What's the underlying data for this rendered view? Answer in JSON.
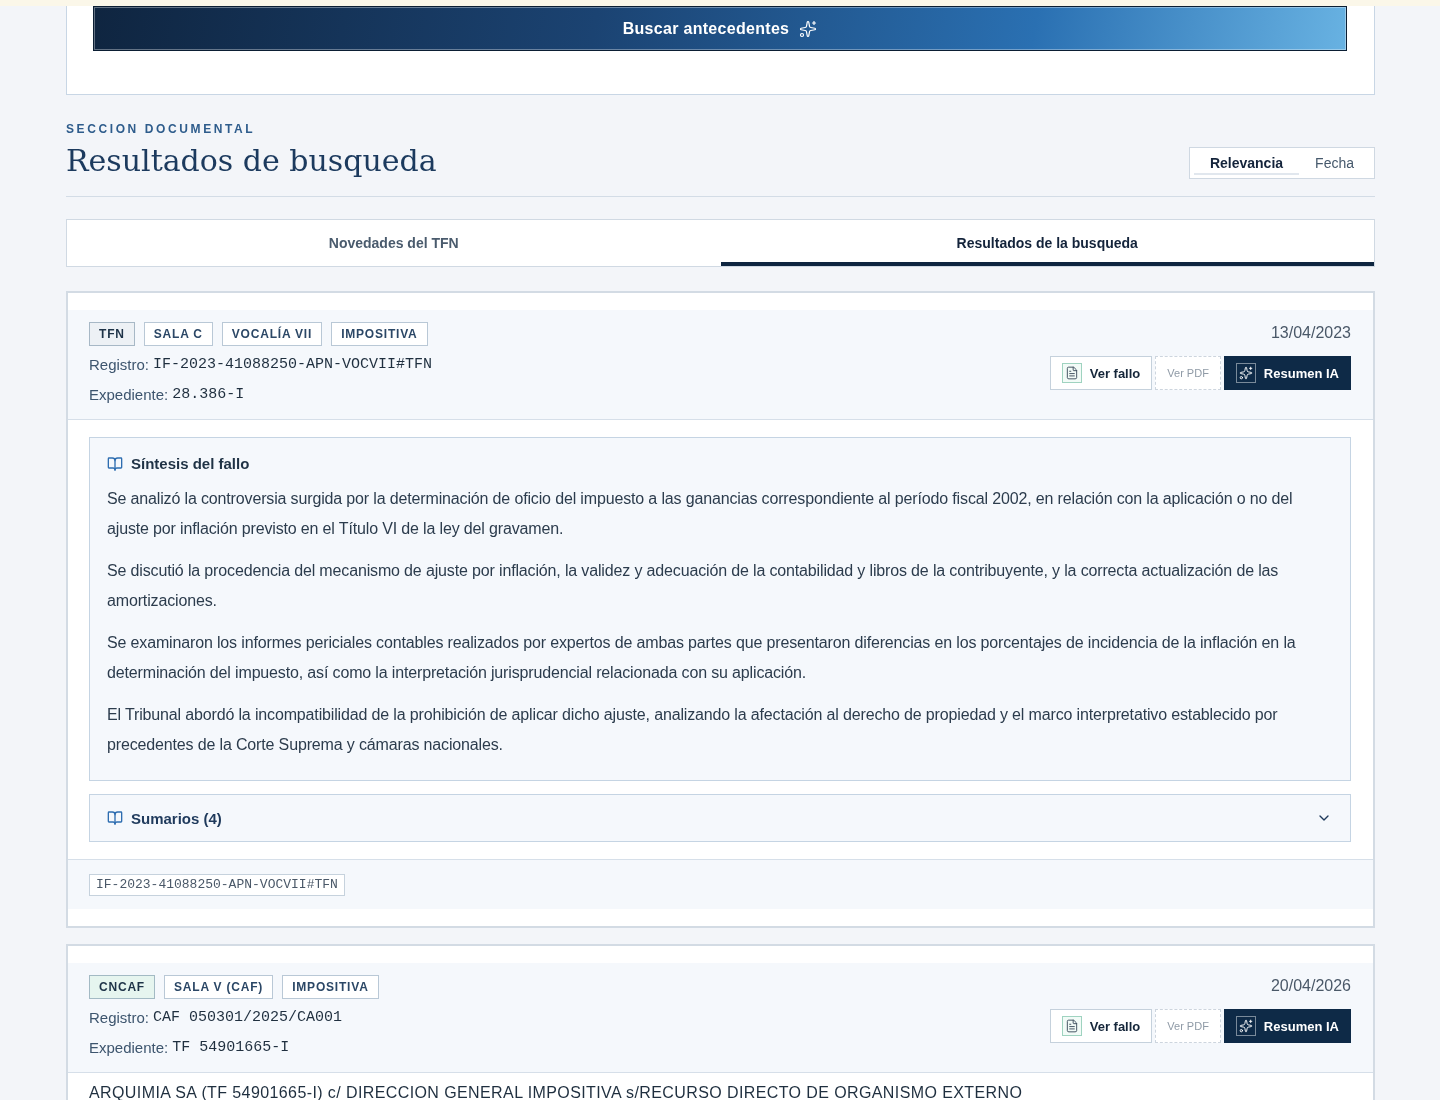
{
  "search_panel": {
    "button_label": "Buscar antecedentes"
  },
  "section_header": {
    "eyebrow": "SECCION DOCUMENTAL",
    "title": "Resultados de busqueda",
    "sort_options": [
      {
        "label": "Relevancia",
        "selected": true
      },
      {
        "label": "Fecha",
        "selected": false
      }
    ]
  },
  "tabs": [
    {
      "label": "Novedades del TFN",
      "selected": false
    },
    {
      "label": "Resultados de la busqueda",
      "selected": true
    }
  ],
  "results": [
    {
      "tags": [
        {
          "label": "TFN",
          "kind": "court",
          "color": "#edf1f5"
        },
        {
          "label": "SALA C",
          "kind": "plain"
        },
        {
          "label": "VOCALÍA VII",
          "kind": "plain"
        },
        {
          "label": "IMPOSITIVA",
          "kind": "plain"
        }
      ],
      "date": "13/04/2023",
      "registro": {
        "label": "Registro:",
        "value": "IF-2023-41088250-APN-VOCVII#TFN"
      },
      "expediente": {
        "label": "Expediente:",
        "value": "28.386-I"
      },
      "actions": [
        {
          "label": "Ver fallo",
          "kind": "document",
          "disabled": false
        },
        {
          "label": "Ver PDF",
          "kind": "plain",
          "disabled": true
        },
        {
          "label": "Resumen IA",
          "kind": "ai",
          "disabled": false
        }
      ],
      "synthesis": {
        "title": "Síntesis del fallo",
        "paragraphs": [
          "Se analizó la controversia surgida por la determinación de oficio del impuesto a las ganancias correspondiente al período fiscal 2002, en relación con la aplicación o no del ajuste por inflación previsto en el Título VI de la ley del gravamen.",
          "Se discutió la procedencia del mecanismo de ajuste por inflación, la validez y adecuación de la contabilidad y libros de la contribuyente, y la correcta actualización de las amortizaciones.",
          "Se examinaron los informes periciales contables realizados por expertos de ambas partes que presentaron diferencias en los porcentajes de incidencia de la inflación en la determinación del impuesto, así como la interpretación jurisprudencial relacionada con su aplicación.",
          "El Tribunal abordó la incompatibilidad de la prohibición de aplicar dicho ajuste, analizando la afectación al derecho de propiedad y el marco interpretativo establecido por precedentes de la Corte Suprema y cámaras nacionales."
        ]
      },
      "summaries": {
        "label": "Sumarios (4)",
        "expanded": false
      },
      "code": "IF-2023-41088250-APN-VOCVII#TFN"
    },
    {
      "tags": [
        {
          "label": "CNCAF",
          "kind": "court",
          "color": "#e6f5ef"
        },
        {
          "label": "SALA V (CAF)",
          "kind": "plain"
        },
        {
          "label": "IMPOSITIVA",
          "kind": "plain"
        }
      ],
      "date": "20/04/2026",
      "registro": {
        "label": "Registro:",
        "value": "CAF 050301/2025/CA001"
      },
      "expediente": {
        "label": "Expediente:",
        "value": "TF 54901665-I"
      },
      "actions": [
        {
          "label": "Ver fallo",
          "kind": "document",
          "disabled": false
        },
        {
          "label": "Ver PDF",
          "kind": "plain",
          "disabled": true
        },
        {
          "label": "Resumen IA",
          "kind": "ai",
          "disabled": false
        }
      ],
      "caption": "ARQUIMIA SA (TF 54901665-I) c/ DIRECCION GENERAL IMPOSITIVA s/RECURSO DIRECTO DE ORGANISMO EXTERNO"
    }
  ]
}
